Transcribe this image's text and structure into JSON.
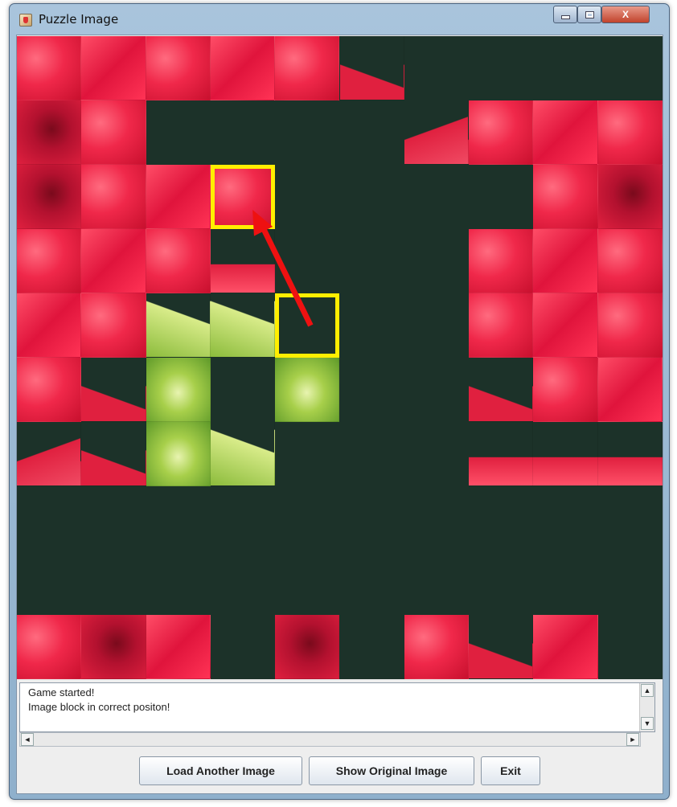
{
  "window": {
    "title": "Puzzle Image",
    "controls": {
      "minimize": "",
      "maximize": "",
      "close": "X"
    }
  },
  "board": {
    "grid_columns": 10,
    "grid_rows": 10,
    "empty_color": "#1c3229",
    "highlight_color": "#ffee00",
    "arrow_color": "#ee1111",
    "tiles": [
      {
        "row": 0,
        "col": 0,
        "tone": "red"
      },
      {
        "row": 0,
        "col": 1,
        "tone": "red2"
      },
      {
        "row": 0,
        "col": 2,
        "tone": "red"
      },
      {
        "row": 0,
        "col": 3,
        "tone": "red2"
      },
      {
        "row": 0,
        "col": 4,
        "tone": "red"
      },
      {
        "row": 0,
        "col": 5,
        "tone": "mix2"
      },
      {
        "row": 1,
        "col": 0,
        "tone": "dark"
      },
      {
        "row": 1,
        "col": 1,
        "tone": "red"
      },
      {
        "row": 1,
        "col": 6,
        "tone": "mix"
      },
      {
        "row": 1,
        "col": 7,
        "tone": "red"
      },
      {
        "row": 1,
        "col": 8,
        "tone": "red2"
      },
      {
        "row": 1,
        "col": 9,
        "tone": "red"
      },
      {
        "row": 2,
        "col": 0,
        "tone": "dark"
      },
      {
        "row": 2,
        "col": 1,
        "tone": "red"
      },
      {
        "row": 2,
        "col": 2,
        "tone": "red2"
      },
      {
        "row": 2,
        "col": 3,
        "tone": "red"
      },
      {
        "row": 2,
        "col": 8,
        "tone": "red"
      },
      {
        "row": 2,
        "col": 9,
        "tone": "dark"
      },
      {
        "row": 3,
        "col": 0,
        "tone": "red"
      },
      {
        "row": 3,
        "col": 1,
        "tone": "red2"
      },
      {
        "row": 3,
        "col": 2,
        "tone": "red"
      },
      {
        "row": 3,
        "col": 3,
        "tone": "mixt"
      },
      {
        "row": 3,
        "col": 7,
        "tone": "red"
      },
      {
        "row": 3,
        "col": 8,
        "tone": "red2"
      },
      {
        "row": 3,
        "col": 9,
        "tone": "red"
      },
      {
        "row": 4,
        "col": 0,
        "tone": "red2"
      },
      {
        "row": 4,
        "col": 1,
        "tone": "red"
      },
      {
        "row": 4,
        "col": 2,
        "tone": "mixg"
      },
      {
        "row": 4,
        "col": 3,
        "tone": "mixg"
      },
      {
        "row": 4,
        "col": 7,
        "tone": "red"
      },
      {
        "row": 4,
        "col": 8,
        "tone": "red2"
      },
      {
        "row": 4,
        "col": 9,
        "tone": "red"
      },
      {
        "row": 5,
        "col": 0,
        "tone": "red"
      },
      {
        "row": 5,
        "col": 1,
        "tone": "mix2"
      },
      {
        "row": 5,
        "col": 2,
        "tone": "green"
      },
      {
        "row": 5,
        "col": 4,
        "tone": "green"
      },
      {
        "row": 5,
        "col": 7,
        "tone": "mix2"
      },
      {
        "row": 5,
        "col": 8,
        "tone": "red"
      },
      {
        "row": 5,
        "col": 9,
        "tone": "red2"
      },
      {
        "row": 6,
        "col": 0,
        "tone": "mix"
      },
      {
        "row": 6,
        "col": 1,
        "tone": "mix2"
      },
      {
        "row": 6,
        "col": 2,
        "tone": "green"
      },
      {
        "row": 6,
        "col": 3,
        "tone": "mixg"
      },
      {
        "row": 6,
        "col": 7,
        "tone": "mixt"
      },
      {
        "row": 6,
        "col": 8,
        "tone": "mixt"
      },
      {
        "row": 6,
        "col": 9,
        "tone": "mixt"
      },
      {
        "row": 9,
        "col": 0,
        "tone": "red"
      },
      {
        "row": 9,
        "col": 1,
        "tone": "dark"
      },
      {
        "row": 9,
        "col": 2,
        "tone": "red2"
      },
      {
        "row": 9,
        "col": 4,
        "tone": "dark"
      },
      {
        "row": 9,
        "col": 6,
        "tone": "red"
      },
      {
        "row": 9,
        "col": 7,
        "tone": "mix2"
      },
      {
        "row": 9,
        "col": 8,
        "tone": "red2"
      }
    ],
    "highlighted_cells": [
      {
        "row": 2,
        "col": 3
      },
      {
        "row": 4,
        "col": 4
      }
    ]
  },
  "log": {
    "lines": [
      "Game started!",
      "Image block in correct positon!"
    ],
    "scroll_up": "▲",
    "scroll_down": "▼",
    "scroll_left": "◄",
    "scroll_right": "►"
  },
  "buttons": {
    "load": "Load Another Image",
    "show": "Show Original Image",
    "exit": "Exit"
  }
}
